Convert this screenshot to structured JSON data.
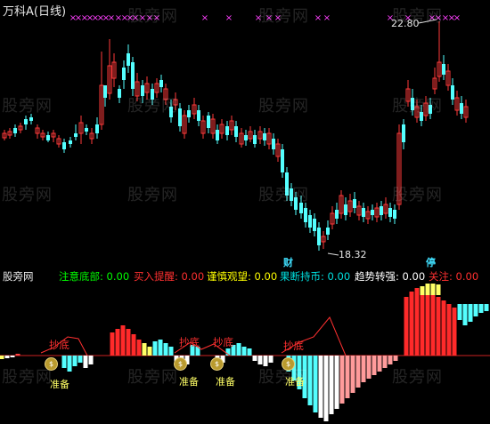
{
  "header": {
    "symbol": "万科A",
    "period": "(日线)"
  },
  "watermark": "股旁网",
  "main_chart": {
    "high_label": "22.80",
    "low_label": "18.32",
    "marker_cai": "财",
    "marker_ting": "停",
    "colors": {
      "up": "#ff3a3a",
      "down": "#54ffff",
      "signal": "#ff40ff"
    }
  },
  "indicator": {
    "name": "股旁网",
    "items": [
      {
        "label": "注意底部:",
        "value": "0.00",
        "color": "#00ff00"
      },
      {
        "label": "买入提醒:",
        "value": "0.00",
        "color": "#ff3030"
      },
      {
        "label": "谨慎观望:",
        "value": "0.00",
        "color": "#ffff00"
      },
      {
        "label": "果断持币:",
        "value": "0.00",
        "color": "#00e0e0"
      },
      {
        "label": "趋势转强:",
        "value": "0.00",
        "color": "#ffffff"
      },
      {
        "label": "关注:",
        "value": "0.00",
        "color": "#ff3030"
      }
    ]
  },
  "annotations": {
    "bottom_signal": "抄底",
    "prepare": "准备"
  }
}
